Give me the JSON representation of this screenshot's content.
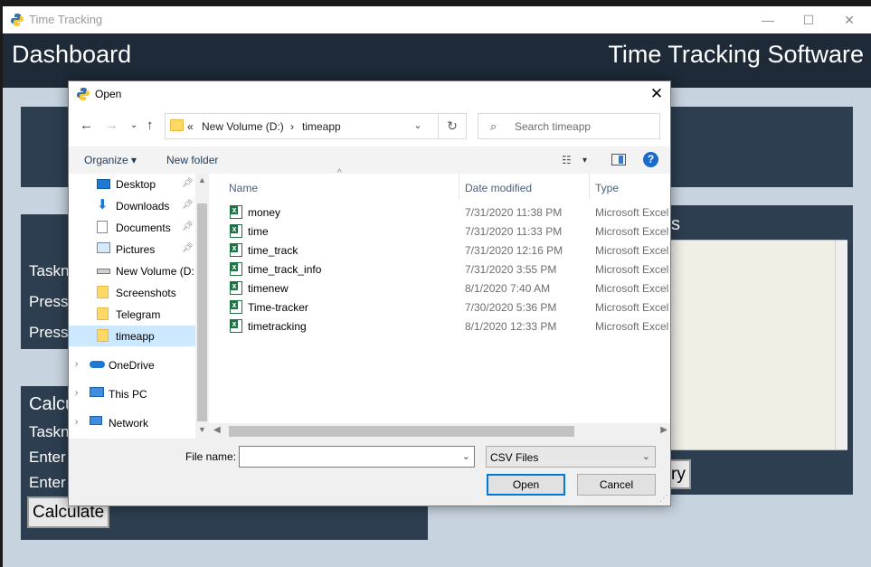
{
  "app": {
    "window_title": "Time Tracking",
    "header_left": "Dashboard",
    "header_right": "Time Tracking Software",
    "background_labels": {
      "taskname_1": "Taskn",
      "press_1": "Press",
      "press_2": "Press",
      "calc_heading": "Calcu",
      "taskname_2": "Taskn",
      "enter_1": "Enter",
      "enter_2": "Enter",
      "panel_heading_fragment": "s",
      "button_fragment": "ry"
    },
    "calculate_button": "Calculate",
    "window_controls": {
      "minimize": "—",
      "maximize": "☐",
      "close": "✕"
    }
  },
  "dialog": {
    "title": "Open",
    "close_glyph": "✕",
    "address": {
      "overflow": "«",
      "drive": "New Volume (D:)",
      "separator": "›",
      "folder": "timeapp"
    },
    "search_placeholder": "Search timeapp",
    "toolbar": {
      "organize": "Organize ▾",
      "new_folder": "New folder",
      "view_toggle": "▾",
      "help": "?"
    },
    "nav_items": [
      {
        "label": "Desktop",
        "icon": "desktop-icon",
        "pinned": true
      },
      {
        "label": "Downloads",
        "icon": "download-icon",
        "pinned": true
      },
      {
        "label": "Documents",
        "icon": "document-icon",
        "pinned": true
      },
      {
        "label": "Pictures",
        "icon": "picture-icon",
        "pinned": true
      },
      {
        "label": "New Volume (D:",
        "icon": "drive-icon",
        "pinned": false
      },
      {
        "label": "Screenshots",
        "icon": "folder-icon",
        "pinned": false
      },
      {
        "label": "Telegram",
        "icon": "folder-icon",
        "pinned": false
      },
      {
        "label": "timeapp",
        "icon": "folder-icon",
        "pinned": false,
        "selected": true
      },
      {
        "label": "OneDrive",
        "icon": "cloud-icon",
        "pinned": false,
        "expandable": true
      },
      {
        "label": "This PC",
        "icon": "computer-icon",
        "pinned": false,
        "expandable": true
      },
      {
        "label": "Network",
        "icon": "network-icon",
        "pinned": false,
        "expandable": true
      }
    ],
    "columns": {
      "name": "Name",
      "date": "Date modified",
      "type": "Type"
    },
    "files": [
      {
        "name": "money",
        "date": "7/31/2020 11:38 PM",
        "type": "Microsoft Excel"
      },
      {
        "name": "time",
        "date": "7/31/2020 11:33 PM",
        "type": "Microsoft Excel"
      },
      {
        "name": "time_track",
        "date": "7/31/2020 12:16 PM",
        "type": "Microsoft Excel"
      },
      {
        "name": "time_track_info",
        "date": "7/31/2020 3:55 PM",
        "type": "Microsoft Excel"
      },
      {
        "name": "timenew",
        "date": "8/1/2020 7:40 AM",
        "type": "Microsoft Excel"
      },
      {
        "name": "Time-tracker",
        "date": "7/30/2020 5:36 PM",
        "type": "Microsoft Excel"
      },
      {
        "name": "timetracking",
        "date": "8/1/2020 12:33 PM",
        "type": "Microsoft Excel"
      }
    ],
    "file_name_label": "File name:",
    "file_name_value": "",
    "file_type": "CSV Files",
    "open_button": "Open",
    "cancel_button": "Cancel"
  },
  "colors": {
    "header_bg": "#1e2a38",
    "panel_bg": "#2c3e50",
    "app_bg": "#c7d3df",
    "selection": "#cce8ff",
    "accent": "#0078d7"
  }
}
